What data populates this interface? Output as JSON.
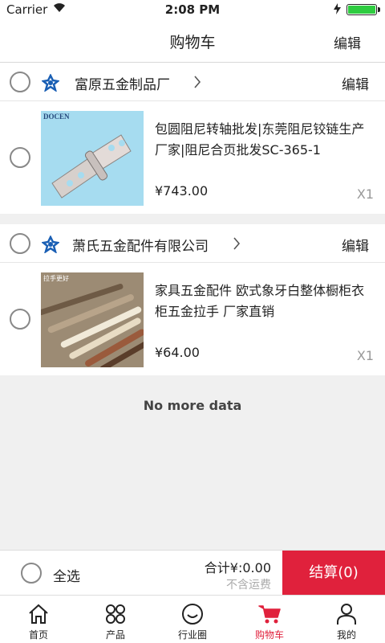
{
  "status": {
    "carrier": "Carrier",
    "time": "2:08 PM"
  },
  "header": {
    "title": "购物车",
    "edit_label": "编辑"
  },
  "shops": [
    {
      "name": "富原五金制品厂",
      "edit_label": "编辑",
      "items": [
        {
          "title": "包圆阻尼转轴批发|东莞阻尼铰链生产厂家|阻尼合页批发SC-365-1",
          "price": "¥743.00",
          "qty": "X1",
          "brand_text": "DOCEN"
        }
      ]
    },
    {
      "name": "萧氏五金配件有限公司",
      "edit_label": "编辑",
      "items": [
        {
          "title": "家具五金配件 欧式象牙白整体橱柜衣柜五金拉手 厂家直销",
          "price": "¥64.00",
          "qty": "X1",
          "brand_text": "拉手更好"
        }
      ]
    }
  ],
  "list_end": "No more data",
  "checkout": {
    "select_all": "全选",
    "total": "合计¥:0.00",
    "shipping_note": "不含运费",
    "pay_button": "结算(0)"
  },
  "tabs": [
    {
      "label": "首页",
      "icon": "home-icon"
    },
    {
      "label": "产品",
      "icon": "grid-icon"
    },
    {
      "label": "行业圈",
      "icon": "smile-icon"
    },
    {
      "label": "购物车",
      "icon": "cart-icon",
      "active": true
    },
    {
      "label": "我的",
      "icon": "user-icon"
    }
  ],
  "colors": {
    "accent": "#e0213c",
    "battery": "#2ecc40",
    "background": "#f0f0f0"
  }
}
